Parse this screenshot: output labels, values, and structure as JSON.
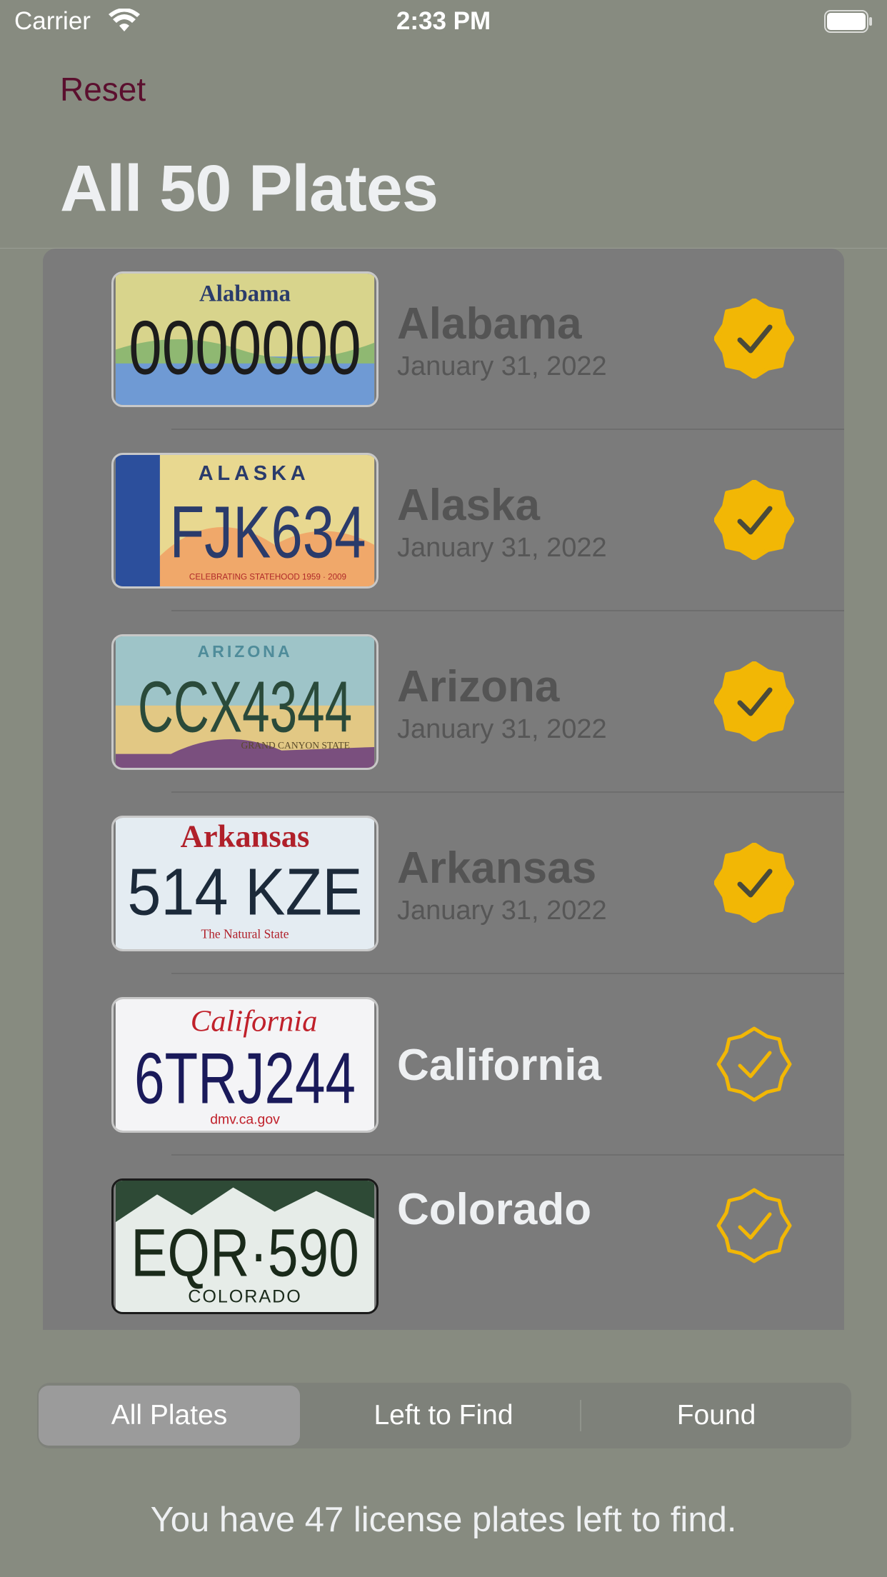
{
  "status_bar": {
    "carrier": "Carrier",
    "time": "2:33 PM"
  },
  "nav": {
    "reset_label": "Reset",
    "title": "All 50 Plates"
  },
  "colors": {
    "badge": "#f2b705",
    "reset": "#5b0f2e",
    "title": "#eef0f2"
  },
  "plates": [
    {
      "state": "Alabama",
      "date": "January 31, 2022",
      "found": true,
      "plate_text": "0000000",
      "plate_header": "Alabama",
      "plate_footer": ""
    },
    {
      "state": "Alaska",
      "date": "January 31, 2022",
      "found": true,
      "plate_text": "FJK634",
      "plate_header": "ALASKA",
      "plate_footer": "CELEBRATING STATEHOOD 1959 · 2009"
    },
    {
      "state": "Arizona",
      "date": "January 31, 2022",
      "found": true,
      "plate_text": "CCX4344",
      "plate_header": "ARIZONA",
      "plate_footer": "GRAND CANYON STATE"
    },
    {
      "state": "Arkansas",
      "date": "January 31, 2022",
      "found": true,
      "plate_text": "514 KZE",
      "plate_header": "Arkansas",
      "plate_footer": "The Natural State"
    },
    {
      "state": "California",
      "date": "",
      "found": false,
      "plate_text": "6TRJ244",
      "plate_header": "California",
      "plate_footer": "dmv.ca.gov"
    },
    {
      "state": "Colorado",
      "date": "",
      "found": false,
      "plate_text": "EQR·590",
      "plate_header": "",
      "plate_footer": "COLORADO"
    }
  ],
  "segments": {
    "all": "All Plates",
    "left": "Left to Find",
    "found": "Found",
    "selected": "All Plates"
  },
  "footer": {
    "message": "You have 47 license plates left to find."
  }
}
